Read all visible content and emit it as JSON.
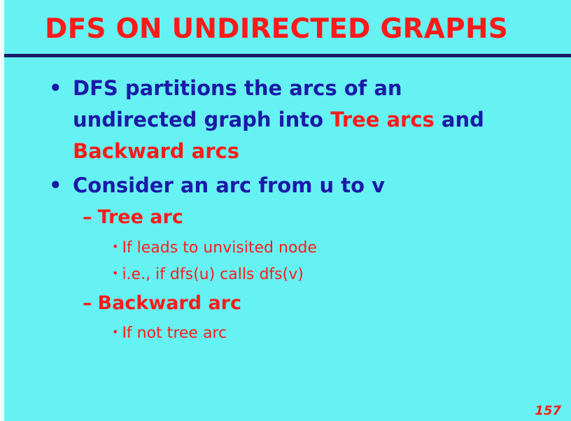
{
  "slide": {
    "title": "DFS ON UNDIRECTED GRAPHS",
    "page_number": "157",
    "bullets": [
      {
        "text_line1": "DFS partitions the arcs of an",
        "text_line2_before": "undirected graph into ",
        "text_line2_highlight": "Tree arcs",
        "text_line2_after": " and",
        "text_line3_highlight": "Backward arcs"
      },
      {
        "text": "Consider an arc from u to v",
        "subitems": [
          {
            "label": "Tree arc",
            "points": [
              "If leads to unvisited node",
              "i.e., if dfs(u) calls dfs(v)"
            ]
          },
          {
            "label": "Backward arc",
            "points": [
              "If not tree arc"
            ]
          }
        ]
      }
    ]
  },
  "colors": {
    "background": "#66f2f2",
    "title": "#ff1a1a",
    "body_text": "#1a1aa8",
    "highlight": "#ff1a1a",
    "rule": "#1a1a66"
  }
}
